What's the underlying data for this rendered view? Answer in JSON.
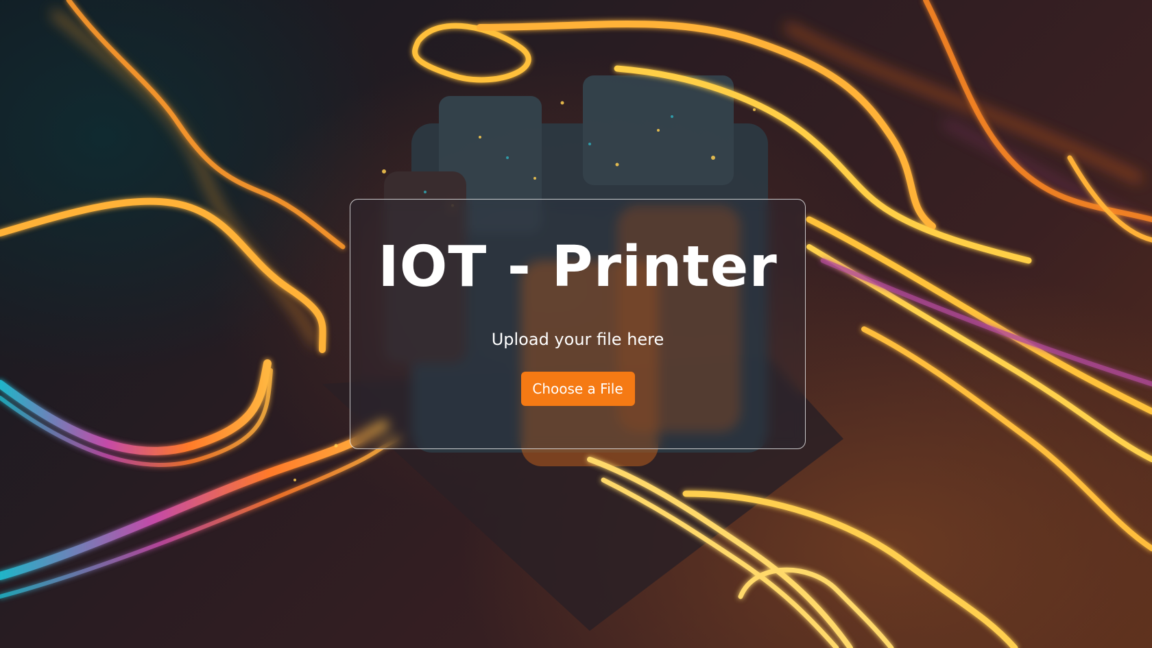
{
  "page": {
    "title": "IOT - Printer",
    "subtitle": "Upload your file here"
  },
  "upload": {
    "button_label": "Choose a File"
  },
  "colors": {
    "accent": "#f57a14",
    "text": "#ffffff",
    "panel_border": "#ffffff"
  },
  "background": {
    "description_icon": "circuit-board-image"
  }
}
